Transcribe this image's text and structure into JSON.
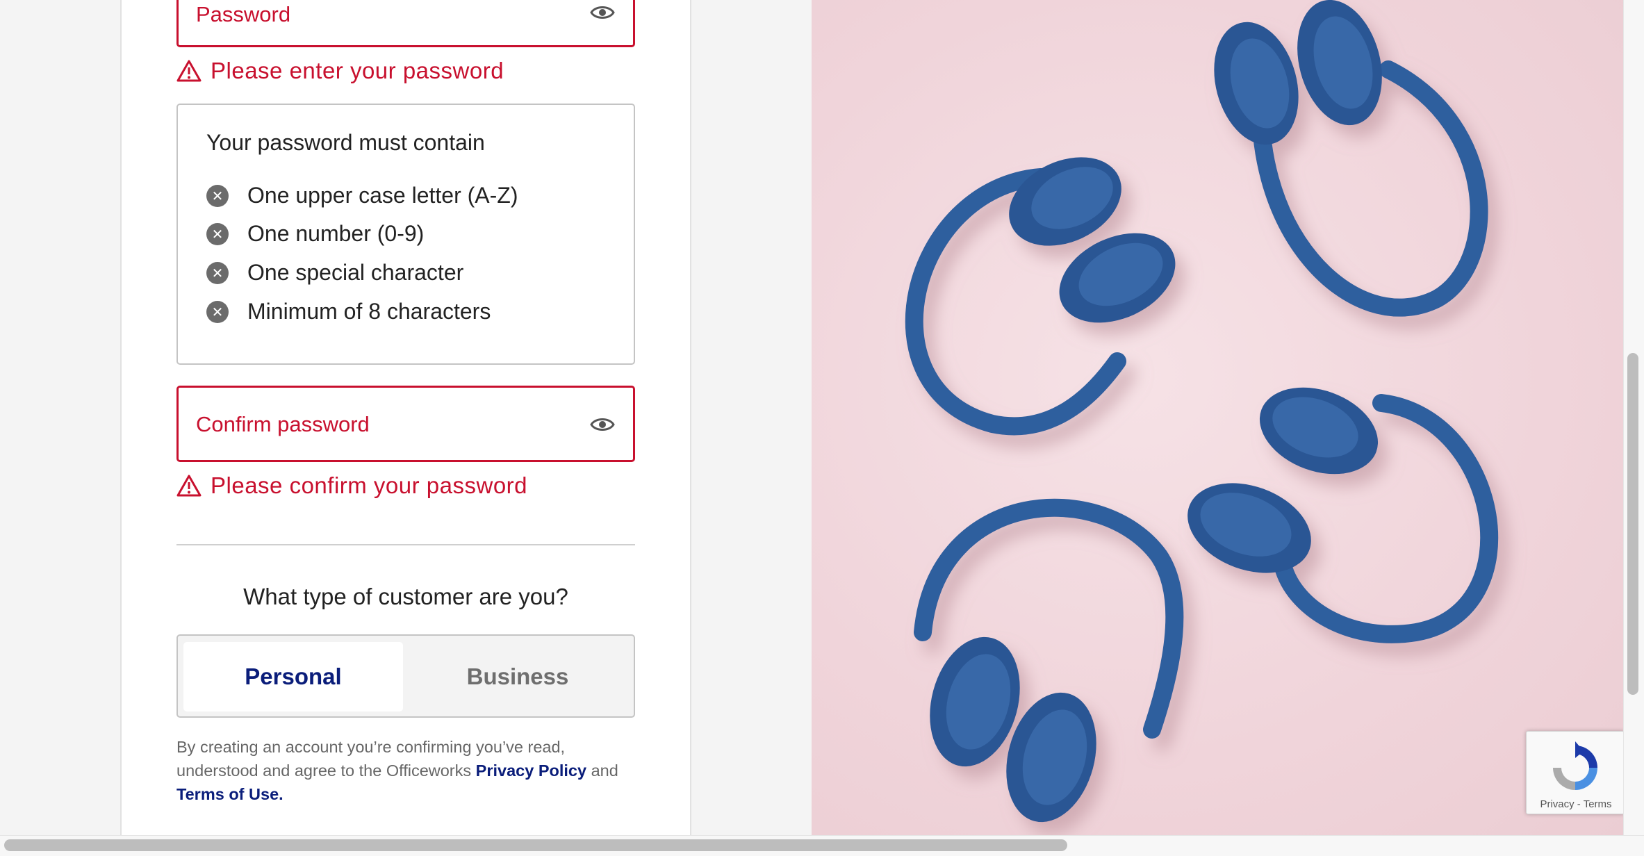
{
  "password_field": {
    "label": "Password",
    "error": "Please enter your password"
  },
  "requirements": {
    "title": "Your password must contain",
    "items": [
      "One upper case letter (A-Z)",
      "One number (0-9)",
      "One special character",
      "Minimum of 8 characters"
    ]
  },
  "confirm_field": {
    "label": "Confirm password",
    "error": "Please confirm your password"
  },
  "customer_type": {
    "question": "What type of customer are you?",
    "options": [
      "Personal",
      "Business"
    ],
    "selected": "Personal"
  },
  "legal": {
    "prefix": "By creating an account you’re confirming you’ve read, understood and agree to the Officeworks",
    "privacy_link": "Privacy Policy",
    "and": "and",
    "terms_link": "Terms of Use."
  },
  "recaptcha": {
    "privacy": "Privacy",
    "separator": "-",
    "terms": "Terms"
  },
  "colors": {
    "error": "#c8102e",
    "brand_navy": "#0a1d7a",
    "hero_bg": "#f0d4da",
    "headphone_blue": "#2f5e9e"
  },
  "hero_image": {
    "icon": "headphones-photo"
  }
}
